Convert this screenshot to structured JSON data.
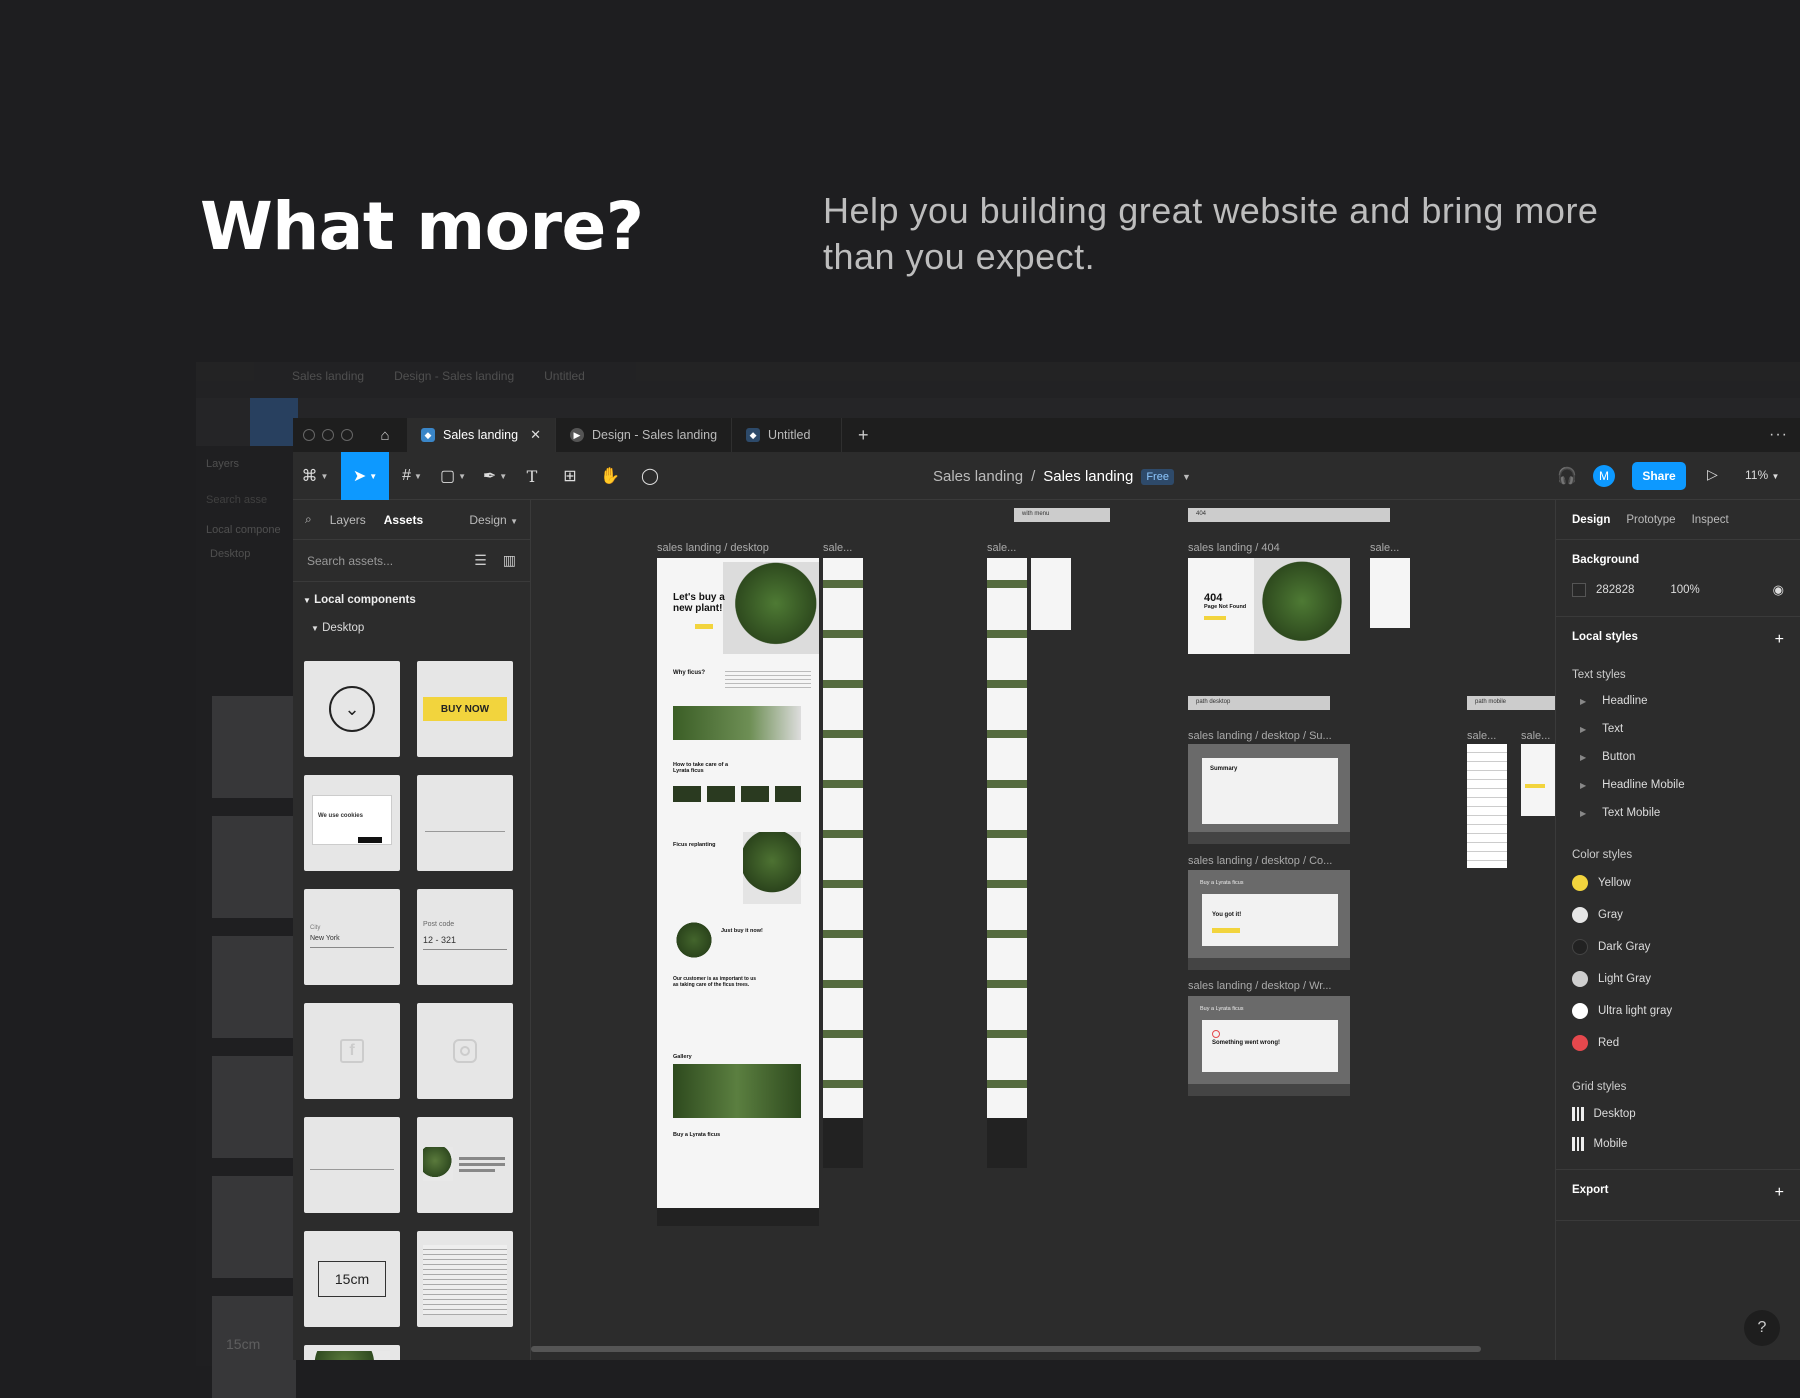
{
  "hero": {
    "title": "What more?",
    "tagline": "Help you building great website  and bring more than you expect."
  },
  "ghost": {
    "tabs": [
      "Sales landing",
      "Design - Sales landing",
      "Untitled"
    ],
    "layers_label": "Layers",
    "search_placeholder": "Search asse",
    "local_components": "Local compone",
    "desktop": "Desktop",
    "size_label": "15cm"
  },
  "tabs": [
    {
      "label": "Sales landing",
      "active": true
    },
    {
      "label": "Design - Sales landing",
      "active": false
    },
    {
      "label": "Untitled",
      "active": false
    }
  ],
  "toolbar": {
    "breadcrumb_project": "Sales landing",
    "breadcrumb_sep": "/",
    "breadcrumb_file": "Sales landing",
    "plan_badge": "Free",
    "avatar_initial": "M",
    "share_label": "Share",
    "zoom": "11%"
  },
  "left_panel": {
    "tab_layers": "Layers",
    "tab_assets": "Assets",
    "page_select": "Design",
    "search_placeholder": "Search assets...",
    "section": "Local components",
    "subsection": "Desktop",
    "tiles": {
      "buy_now": "BUY NOW",
      "cookies_title": "We use cookies",
      "city_label": "City",
      "city_value": "New York",
      "postcode_label": "Post code",
      "postcode_value": "12 - 321",
      "size_value": "15cm"
    }
  },
  "canvas": {
    "frames": [
      {
        "label": "sales landing / desktop"
      },
      {
        "label": "sale..."
      },
      {
        "label": "sale..."
      },
      {
        "label": "sales landing / 404"
      },
      {
        "label": "sale..."
      },
      {
        "label": "sales landing / desktop / Su..."
      },
      {
        "label": "sales landing / desktop / Co..."
      },
      {
        "label": "sales landing / desktop / Wr..."
      },
      {
        "label": "sale..."
      },
      {
        "label": "sale..."
      }
    ],
    "section_bars": {
      "with_menu": "with menu",
      "e404": "404",
      "path_desktop": "path desktop",
      "path_mobile": "path mobile"
    },
    "hero_text": "Let's buy a new plant!",
    "why": "Why ficus?",
    "care": "How to take care of a Lyrata ficus",
    "replant": "Ficus replanting",
    "buy_it": "Just buy it now!",
    "customer": "Our customer is as important to us as taking care of the ficus trees.",
    "gallery": "Gallery",
    "buy_lyrata": "Buy a Lyrata ficus",
    "e404_title": "404",
    "e404_sub": "Page Not Found",
    "summary": "Summary",
    "got_it": "You got it!",
    "wrong": "Something went wrong!",
    "buy_ficus": "Buy a Lyrata ficus"
  },
  "right_panel": {
    "tabs": [
      "Design",
      "Prototype",
      "Inspect"
    ],
    "background_title": "Background",
    "bg_hex": "282828",
    "bg_opacity": "100%",
    "local_styles": "Local styles",
    "text_styles_title": "Text styles",
    "text_styles": [
      "Headline",
      "Text",
      "Button",
      "Headline Mobile",
      "Text Mobile"
    ],
    "color_styles_title": "Color styles",
    "color_styles": [
      {
        "name": "Yellow",
        "color": "#f2d43d"
      },
      {
        "name": "Gray",
        "color": "#e6e6e6"
      },
      {
        "name": "Dark Gray",
        "color": "#222222"
      },
      {
        "name": "Light Gray",
        "color": "#cfcfcf"
      },
      {
        "name": "Ultra light gray",
        "color": "#ffffff"
      },
      {
        "name": "Red",
        "color": "#e5484d"
      }
    ],
    "grid_styles_title": "Grid styles",
    "grid_styles": [
      "Desktop",
      "Mobile"
    ],
    "export": "Export",
    "help": "?"
  },
  "colors": {
    "accent": "#0d99ff",
    "yellow": "#f2d43d",
    "page_bg": "#1e1e20"
  }
}
